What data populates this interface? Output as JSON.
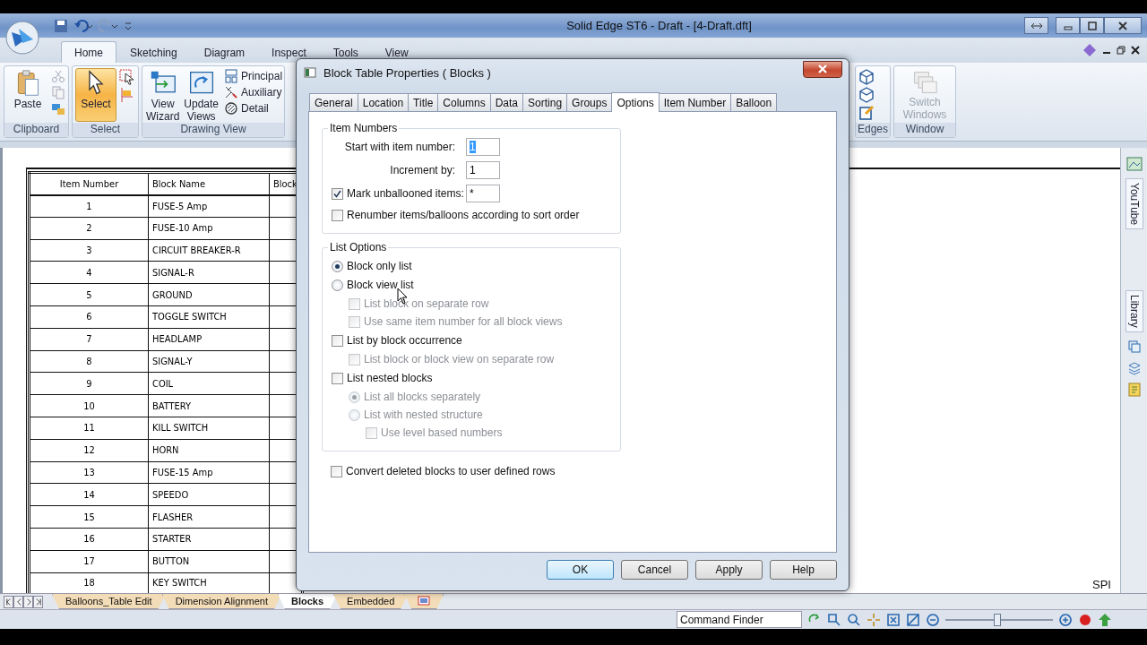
{
  "window": {
    "title": "Solid Edge ST6 - Draft - [4-Draft.dft]"
  },
  "ribbon_tabs": [
    {
      "label": "Home",
      "selected": true
    },
    {
      "label": "Sketching",
      "selected": false
    },
    {
      "label": "Diagram",
      "selected": false
    },
    {
      "label": "Inspect",
      "selected": false
    },
    {
      "label": "Tools",
      "selected": false
    },
    {
      "label": "View",
      "selected": false
    }
  ],
  "ribbon_groups": [
    {
      "kind": "clipboard",
      "label": "Clipboard",
      "buttons": [
        {
          "label": "Paste",
          "active": false,
          "disabled": false
        }
      ]
    },
    {
      "kind": "select",
      "label": "Select",
      "buttons": [
        {
          "label": "Select",
          "active": true,
          "disabled": false
        }
      ]
    },
    {
      "kind": "views",
      "label": "Drawing View",
      "buttons": [
        {
          "label": "View Wizard",
          "active": false,
          "disabled": false
        },
        {
          "label": "Update Views",
          "active": false,
          "disabled": false
        }
      ],
      "small_buttons": [
        "Principal",
        "Auxiliary",
        "Detail"
      ]
    },
    {
      "kind": "edges",
      "label": "Edges"
    },
    {
      "kind": "window",
      "label": "Window",
      "buttons": [
        {
          "label": "Switch Windows",
          "active": false,
          "disabled": true
        }
      ]
    }
  ],
  "block_table": {
    "columns": [
      "Item Number",
      "Block Name",
      "Block"
    ],
    "rows": [
      [
        "1",
        "FUSE-5 Amp"
      ],
      [
        "2",
        "FUSE-10 Amp"
      ],
      [
        "3",
        "CIRCUIT BREAKER-R"
      ],
      [
        "4",
        "SIGNAL-R"
      ],
      [
        "5",
        "GROUND"
      ],
      [
        "6",
        "TOGGLE SWITCH"
      ],
      [
        "7",
        "HEADLAMP"
      ],
      [
        "8",
        "SIGNAL-Y"
      ],
      [
        "9",
        "COIL"
      ],
      [
        "10",
        "BATTERY"
      ],
      [
        "11",
        "KILL SWITCH"
      ],
      [
        "12",
        "HORN"
      ],
      [
        "13",
        "FUSE-15 Amp"
      ],
      [
        "14",
        "SPEEDO"
      ],
      [
        "15",
        "FLASHER"
      ],
      [
        "16",
        "STARTER"
      ],
      [
        "17",
        "BUTTON"
      ],
      [
        "18",
        "KEY SWITCH"
      ]
    ]
  },
  "canvas_text": "SPI",
  "side_panel": {
    "tabs": [
      "YouTube",
      "Library"
    ]
  },
  "dialog": {
    "title": "Block Table Properties ( Blocks )",
    "tabs": [
      {
        "label": "General",
        "selected": false
      },
      {
        "label": "Location",
        "selected": false
      },
      {
        "label": "Title",
        "selected": false
      },
      {
        "label": "Columns",
        "selected": false
      },
      {
        "label": "Data",
        "selected": false
      },
      {
        "label": "Sorting",
        "selected": false
      },
      {
        "label": "Groups",
        "selected": false
      },
      {
        "label": "Options",
        "selected": true
      },
      {
        "label": "Item Number",
        "selected": false
      },
      {
        "label": "Balloon",
        "selected": false
      }
    ],
    "item_numbers": {
      "title": "Item Numbers",
      "fields": [
        {
          "label": "Start with item number:",
          "value": "1",
          "highlighted": true
        },
        {
          "label": "Increment by:",
          "value": "1",
          "highlighted": false
        }
      ],
      "mark": {
        "label": "Mark unballooned items:",
        "checked": true,
        "value": "*"
      },
      "renumber": {
        "label": "Renumber items/balloons according to sort order",
        "checked": false
      }
    },
    "list_options": {
      "title": "List Options",
      "items": [
        {
          "kind": "radio",
          "label": "Block only list",
          "selected": true,
          "disabled": false
        },
        {
          "kind": "radio",
          "label": "Block view list",
          "selected": false,
          "disabled": false,
          "children": [
            {
              "kind": "checkbox",
              "label": "List block on separate row",
              "checked": false,
              "disabled": true
            },
            {
              "kind": "checkbox",
              "label": "Use same item number for all block views",
              "checked": false,
              "disabled": true
            }
          ]
        },
        {
          "kind": "checkbox",
          "label": "List by block occurrence",
          "checked": false,
          "disabled": false,
          "children": [
            {
              "kind": "checkbox",
              "label": "List block or block view on separate row",
              "checked": false,
              "disabled": true
            }
          ]
        },
        {
          "kind": "checkbox",
          "label": "List nested blocks",
          "checked": false,
          "disabled": false,
          "children": [
            {
              "kind": "radio",
              "label": "List all blocks separately",
              "selected": true,
              "disabled": true
            },
            {
              "kind": "radio",
              "label": "List with nested structure",
              "selected": false,
              "disabled": true,
              "children": [
                {
                  "kind": "checkbox",
                  "label": "Use level based numbers",
                  "checked": false,
                  "disabled": true
                }
              ]
            }
          ]
        }
      ]
    },
    "convert": {
      "label": "Convert deleted blocks to user defined rows",
      "checked": false
    },
    "buttons": [
      {
        "label": "OK",
        "default": true
      },
      {
        "label": "Cancel",
        "default": false
      },
      {
        "label": "Apply",
        "default": false
      },
      {
        "label": "Help",
        "default": false
      }
    ]
  },
  "sheet_tabs": [
    {
      "kind": "text",
      "label": "Balloons_Table Edit",
      "selected": false
    },
    {
      "kind": "text",
      "label": "Dimension Alignment",
      "selected": false
    },
    {
      "kind": "text",
      "label": "Blocks",
      "selected": true
    },
    {
      "kind": "text",
      "label": "Embedded",
      "selected": false
    },
    {
      "kind": "icon",
      "selected": false
    }
  ],
  "status_bar": {
    "command_finder": {
      "placeholder": "Command Finder"
    },
    "zoom": {
      "level": 0.48
    }
  }
}
